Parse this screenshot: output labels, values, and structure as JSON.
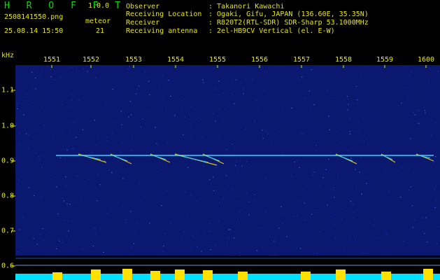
{
  "header": {
    "logo": "H R O F F T",
    "version": "1.0.0",
    "filename": "2508141550.png",
    "datetime": "25.08.14 15:50",
    "meteor_label": "meteor",
    "meteor_count": "21"
  },
  "info": [
    {
      "label": "Observer",
      "value": ": Takanori Kawachi"
    },
    {
      "label": "Receiving Location",
      "value": ": Ogaki, Gifu, JAPAN (136.60E, 35.35N)"
    },
    {
      "label": "Receiver",
      "value": ": R820T2(RTL-SDR) SDR-Sharp 53.1000MHz"
    },
    {
      "label": "Receiving antenna",
      "value": ": 2el-HB9CV Vertical (el. E-W)"
    }
  ],
  "spectrogram": {
    "unit": "kHz",
    "time_ticks": [
      "1551",
      "1552",
      "1553",
      "1554",
      "1555",
      "1556",
      "1557",
      "1558",
      "1559",
      "1600"
    ],
    "freq_ticks": [
      "1.1",
      "1.0",
      "0.9",
      "0.8",
      "0.7",
      "0.6"
    ],
    "carrier_khz": 0.91,
    "colors": {
      "text": "#e8e800",
      "logo": "#00e000",
      "background": "#000000",
      "noise": "#0a1870",
      "carrier": "#40d0ff",
      "echo": "#ffe000",
      "power": "#00e0ff"
    }
  }
}
